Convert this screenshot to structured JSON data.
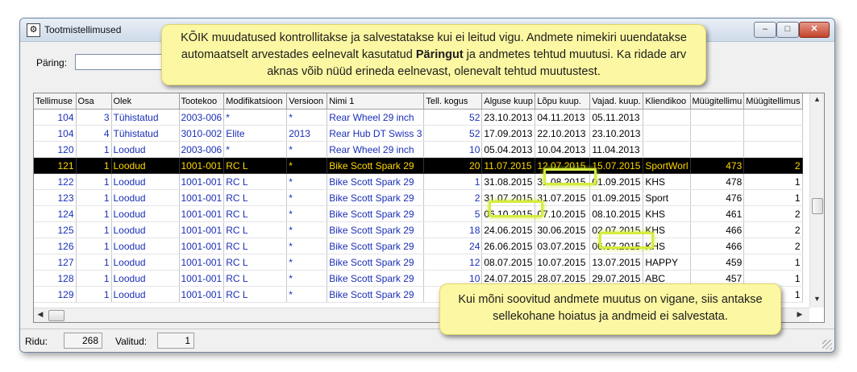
{
  "window": {
    "title": "Tootmistellimused"
  },
  "query": {
    "label": "Päring:",
    "value": ""
  },
  "table": {
    "columns": [
      "Tellimuse",
      "Osa",
      "Olek",
      "Tootekoo",
      "Modifikatsioon",
      "Versioon",
      "Nimi 1",
      "Tell. kogus",
      "Alguse kuup",
      "Lõpu kuup.",
      "Vajad. kuup.",
      "Kliendikoo",
      "Müügitellimu",
      "Müügitellimus"
    ],
    "rows": [
      [
        "104",
        "3",
        "Tühistatud",
        "2003-006",
        "*",
        "*",
        "Rear Wheel 29 inch",
        "52",
        "23.10.2013",
        "04.11.2013",
        "05.11.2013",
        "",
        "",
        ""
      ],
      [
        "104",
        "4",
        "Tühistatud",
        "3010-002",
        "Elite",
        "2013",
        "Rear Hub DT Swiss 3",
        "52",
        "17.09.2013",
        "22.10.2013",
        "23.10.2013",
        "",
        "",
        ""
      ],
      [
        "120",
        "1",
        "Loodud",
        "2003-006",
        "*",
        "*",
        "Rear Wheel 29 inch",
        "10",
        "05.04.2013",
        "10.04.2013",
        "11.04.2013",
        "",
        "",
        ""
      ],
      [
        "121",
        "1",
        "Loodud",
        "1001-001",
        "RC L",
        "*",
        "Bike Scott Spark 29",
        "20",
        "11.07.2015",
        "12.07.2015",
        "15.07.2015",
        "SportWorl",
        "473",
        "2"
      ],
      [
        "122",
        "1",
        "Loodud",
        "1001-001",
        "RC L",
        "*",
        "Bike Scott Spark 29",
        "1",
        "31.08.2015",
        "31.08.2015",
        "01.09.2015",
        "KHS",
        "478",
        "1"
      ],
      [
        "123",
        "1",
        "Loodud",
        "1001-001",
        "RC L",
        "*",
        "Bike Scott Spark 29",
        "2",
        "31.07.2015",
        "31.07.2015",
        "01.09.2015",
        "Sport",
        "476",
        "1"
      ],
      [
        "124",
        "1",
        "Loodud",
        "1001-001",
        "RC L",
        "*",
        "Bike Scott Spark 29",
        "5",
        "06.10.2015",
        "07.10.2015",
        "08.10.2015",
        "KHS",
        "461",
        "2"
      ],
      [
        "125",
        "1",
        "Loodud",
        "1001-001",
        "RC L",
        "*",
        "Bike Scott Spark 29",
        "18",
        "24.06.2015",
        "30.06.2015",
        "02.07.2015",
        "KHS",
        "466",
        "2"
      ],
      [
        "126",
        "1",
        "Loodud",
        "1001-001",
        "RC L",
        "*",
        "Bike Scott Spark 29",
        "24",
        "26.06.2015",
        "03.07.2015",
        "06.07.2015",
        "KHS",
        "466",
        "2"
      ],
      [
        "127",
        "1",
        "Loodud",
        "1001-001",
        "RC L",
        "*",
        "Bike Scott Spark 29",
        "12",
        "08.07.2015",
        "10.07.2015",
        "13.07.2015",
        "HAPPY",
        "459",
        "1"
      ],
      [
        "128",
        "1",
        "Loodud",
        "1001-001",
        "RC L",
        "*",
        "Bike Scott Spark 29",
        "10",
        "24.07.2015",
        "28.07.2015",
        "29.07.2015",
        "ABC",
        "457",
        "1"
      ],
      [
        "129",
        "1",
        "Loodud",
        "1001-001",
        "RC L",
        "*",
        "Bike Scott Spark 29",
        "",
        "",
        "",
        "",
        "",
        "",
        "1"
      ]
    ],
    "selected_row": 3
  },
  "status": {
    "rows_label": "Ridu:",
    "rows_value": "268",
    "selected_label": "Valitud:",
    "selected_value": "1"
  },
  "callouts": {
    "top_part1": "KÕIK muudatused kontrollitakse ja salvestatakse kui ei leitud vigu. Andmete nimekiri uuendatakse automaatselt arvestades eelnevalt kasutatud ",
    "top_bold": "Päringut",
    "top_part2": " ja andmetes tehtud muutusi. Ka ridade arv aknas võib nüüd erineda eelnevast, olenevalt tehtud muutustest.",
    "bottom": "Kui mõni soovitud andmete muutus on vigane, siis antakse sellekohane hoiatus ja andmeid ei salvestata."
  },
  "colors": {
    "callout_bg": "#fcf7a2",
    "highlight": "#d6ec3c",
    "selected_row_bg": "#000000",
    "selected_row_text": "#ffd800",
    "link_blue": "#1a2fb8"
  },
  "icons": [
    "window-app-icon",
    "minimize-icon",
    "maximize-icon",
    "close-icon",
    "scroll-up-arrow-icon",
    "scroll-down-arrow-icon",
    "scroll-left-arrow-icon",
    "scroll-right-arrow-icon",
    "resize-grip-icon"
  ]
}
